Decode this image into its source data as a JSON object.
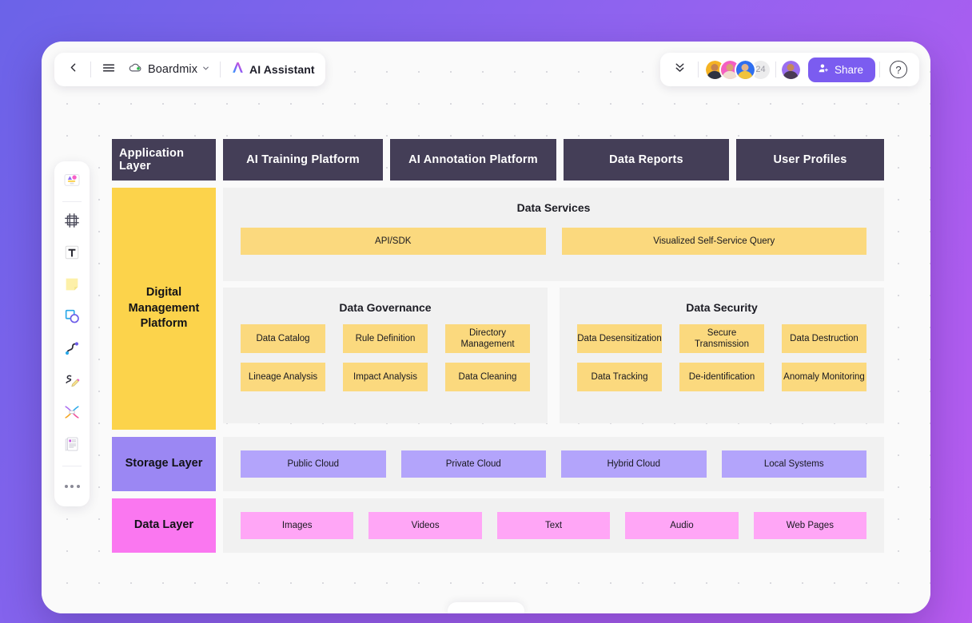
{
  "app": {
    "toolbar_left": {
      "back_icon": "chevron-left-icon",
      "menu_icon": "hamburger-menu-icon",
      "logo_icon": "boardmix-cloud-icon",
      "doc_name": "Boardmix",
      "doc_dropdown_icon": "chevron-down-icon",
      "ai_icon": "ai-sparkle-icon",
      "ai_label": "AI Assistant"
    },
    "toolbar_right": {
      "collapse_icon": "double-chevron-down-icon",
      "collaborator_count": "24",
      "avatars": [
        {
          "name": "collaborator-1",
          "ring": "#f5b324",
          "skin": "#c4824f",
          "shirt": "#2f3340"
        },
        {
          "name": "collaborator-2",
          "ring": "#f55fc2",
          "skin": "#d9a273",
          "shirt": "#f0ddd0"
        },
        {
          "name": "collaborator-3",
          "ring": "#2f6ff0",
          "skin": "#e3b489",
          "shirt": "#f0c33c"
        }
      ],
      "current_user_avatar": {
        "name": "current-user",
        "ring": "#9b6ef0",
        "skin": "#c4885c",
        "shirt": "#4a3a55"
      },
      "share_icon": "person-add-icon",
      "share_label": "Share",
      "help_icon": "question-mark-icon",
      "share_button_color": "#7b5cf0"
    },
    "tool_rail": [
      {
        "name": "templates-tool",
        "icon": "templates-icon"
      },
      {
        "name": "frame-tool",
        "icon": "frame-icon"
      },
      {
        "name": "text-tool",
        "icon": "text-icon"
      },
      {
        "name": "sticky-note-tool",
        "icon": "sticky-note-icon"
      },
      {
        "name": "shape-tool",
        "icon": "shape-icon"
      },
      {
        "name": "connector-tool",
        "icon": "curve-connector-icon"
      },
      {
        "name": "pen-tool",
        "icon": "pen-icon"
      },
      {
        "name": "mindmap-tool",
        "icon": "mindmap-icon"
      },
      {
        "name": "document-tool",
        "icon": "document-icon"
      },
      {
        "name": "more-tools",
        "icon": "more-dots-icon"
      }
    ]
  },
  "colors": {
    "dark_header": "#443e57",
    "label_yellow": "#fcd34b",
    "label_purple": "#9b87f3",
    "label_pink": "#fa77f0",
    "chip_yellow": "#fbd97e",
    "chip_purple": "#b3a4fb",
    "chip_pink": "#ffa6f6",
    "panel_bg": "#f1f1f1",
    "accent": "#7b5cf0"
  },
  "diagram": {
    "application_layer": {
      "title": "Application Layer",
      "items": [
        "AI Training Platform",
        "AI Annotation Platform",
        "Data Reports",
        "User Profiles"
      ]
    },
    "platform_layer": {
      "label": "Digital Management Platform",
      "services": {
        "title": "Data Services",
        "items": [
          "API/SDK",
          "Visualized Self-Service Query"
        ]
      },
      "governance": {
        "title": "Data Governance",
        "items": [
          "Data Catalog",
          "Rule Definition",
          "Directory Management",
          "Lineage Analysis",
          "Impact Analysis",
          "Data Cleaning"
        ]
      },
      "security": {
        "title": "Data Security",
        "items": [
          "Data Desensitization",
          "Secure Transmission",
          "Data Destruction",
          "Data Tracking",
          "De-identification",
          "Anomaly Monitoring"
        ]
      }
    },
    "storage_layer": {
      "label": "Storage Layer",
      "items": [
        "Public Cloud",
        "Private Cloud",
        "Hybrid Cloud",
        "Local Systems"
      ]
    },
    "data_layer": {
      "label": "Data Layer",
      "items": [
        "Images",
        "Videos",
        "Text",
        "Audio",
        "Web Pages"
      ]
    }
  }
}
